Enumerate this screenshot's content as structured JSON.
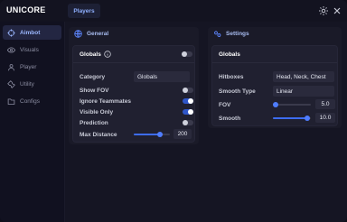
{
  "app": {
    "title": "UNICORE"
  },
  "header": {
    "active_tab": "Players",
    "settings_icon": "gear-icon",
    "close_icon": "close-icon"
  },
  "sidebar": {
    "items": [
      {
        "label": "Aimbot",
        "icon": "crosshair-icon",
        "active": true
      },
      {
        "label": "Visuals",
        "icon": "eye-icon",
        "active": false
      },
      {
        "label": "Player",
        "icon": "user-icon",
        "active": false
      },
      {
        "label": "Utility",
        "icon": "tool-icon",
        "active": false
      },
      {
        "label": "Configs",
        "icon": "folder-icon",
        "active": false
      }
    ]
  },
  "general": {
    "title": "General",
    "icon": "globe-icon",
    "card_title": "Globals",
    "card_toggle": false,
    "category": {
      "label": "Category",
      "value": "Globals"
    },
    "show_fov": {
      "label": "Show FOV",
      "value": false
    },
    "ignore_teammates": {
      "label": "Ignore Teammates",
      "value": true
    },
    "visible_only": {
      "label": "Visible Only",
      "value": true
    },
    "prediction": {
      "label": "Prediction",
      "value": false
    },
    "max_distance": {
      "label": "Max Distance",
      "value": "200",
      "fraction": 0.72
    }
  },
  "settings": {
    "title": "Settings",
    "icon": "gears-icon",
    "card_title": "Globals",
    "hitboxes": {
      "label": "Hitboxes",
      "value": "Head, Neck, Chest"
    },
    "smooth_type": {
      "label": "Smooth Type",
      "value": "Linear"
    },
    "fov": {
      "label": "FOV",
      "value": "5.0",
      "fraction": 0.08
    },
    "smooth": {
      "label": "Smooth",
      "value": "10.0",
      "fraction": 0.9
    }
  },
  "colors": {
    "accent": "#3d6cf0",
    "background": "#12121e",
    "panel": "#1a1a28"
  }
}
